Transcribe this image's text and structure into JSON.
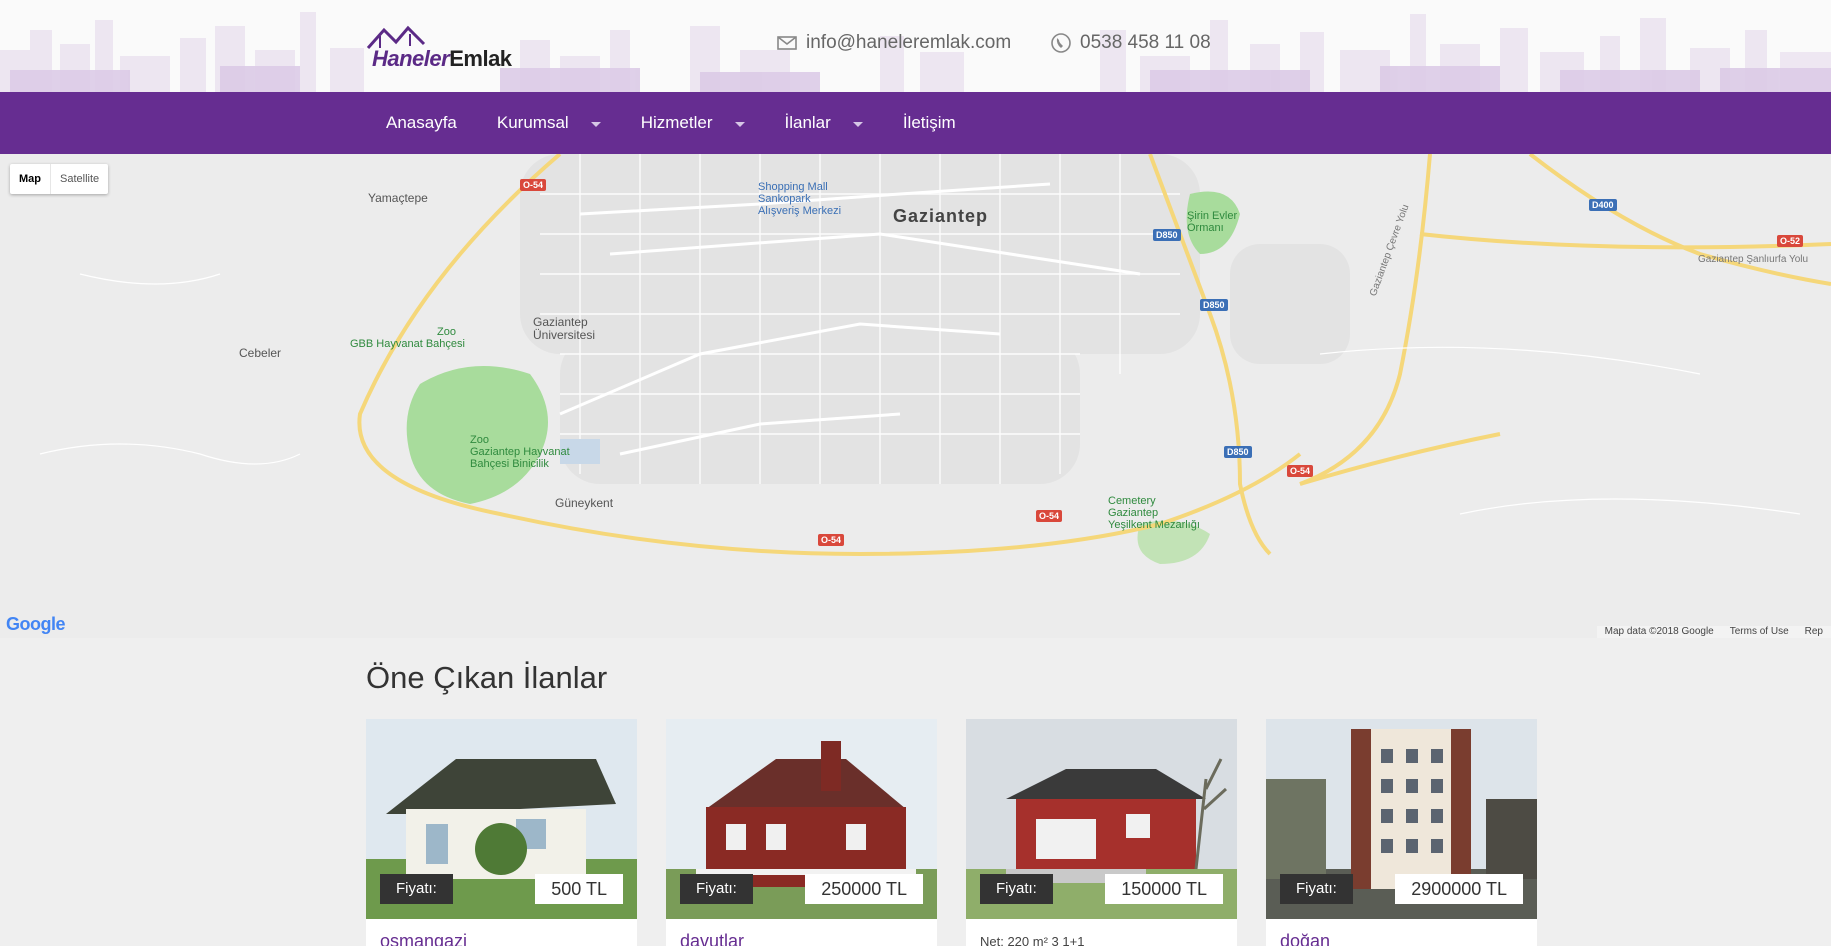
{
  "header": {
    "logo": {
      "word1": "Haneler",
      "word2": "Emlak"
    },
    "email": "info@haneleremlak.com",
    "phone": "0538 458 11 08"
  },
  "nav": {
    "items": [
      {
        "label": "Anasayfa",
        "has_dropdown": false
      },
      {
        "label": "Kurumsal",
        "has_dropdown": true
      },
      {
        "label": "Hizmetler",
        "has_dropdown": true
      },
      {
        "label": "İlanlar",
        "has_dropdown": true
      },
      {
        "label": "İletişim",
        "has_dropdown": false
      }
    ]
  },
  "map": {
    "type_buttons": {
      "map": "Map",
      "satellite": "Satellite"
    },
    "city": "Gaziantep",
    "places": {
      "yamactepe": "Yamaçtepe",
      "cebeler": "Cebeler",
      "guneykent": "Güneykent",
      "shopping1": "Shopping Mall",
      "shopping2": "Sankopark",
      "shopping3": "Alışveriş Merkezi",
      "univ1": "Gaziantep",
      "univ2": "Üniversitesi",
      "zoo1": "Zoo",
      "zoo1_sub": "GBB Hayvanat Bahçesi",
      "zoo2": "Zoo",
      "zoo2_sub1": "Gaziantep Hayvanat",
      "zoo2_sub2": "Bahçesi Binicilik",
      "park1": "Şirin Evler",
      "park2": "Ormanı",
      "cem1": "Cemetery",
      "cem2": "Gaziantep",
      "cem3": "Yeşilkent Mezarlığı",
      "road_sanliurfa": "Gaziantep Şanlıurfa Yolu",
      "road_cevre": "Gaziantep Çevre Yolu"
    },
    "shields": {
      "o54": "O-54",
      "d850": "D850",
      "d400": "D400",
      "o52": "O-52"
    },
    "google": "Google",
    "footer": {
      "data": "Map data ©2018 Google",
      "terms": "Terms of Use",
      "report": "Rep"
    }
  },
  "featured": {
    "title": "Öne Çıkan İlanlar",
    "price_label": "Fiyatı:",
    "cards": [
      {
        "price": "500 TL",
        "title": "osmangazi"
      },
      {
        "price": "250000 TL",
        "title": "davutlar"
      },
      {
        "price": "150000 TL",
        "meta": "Net: 220 m²    3    1+1"
      },
      {
        "price": "2900000 TL",
        "title": "doğan"
      }
    ]
  },
  "colors": {
    "brand": "#662d91",
    "map_road": "#f5d77a",
    "map_bg": "#ececec",
    "park": "#a8dc9c"
  }
}
